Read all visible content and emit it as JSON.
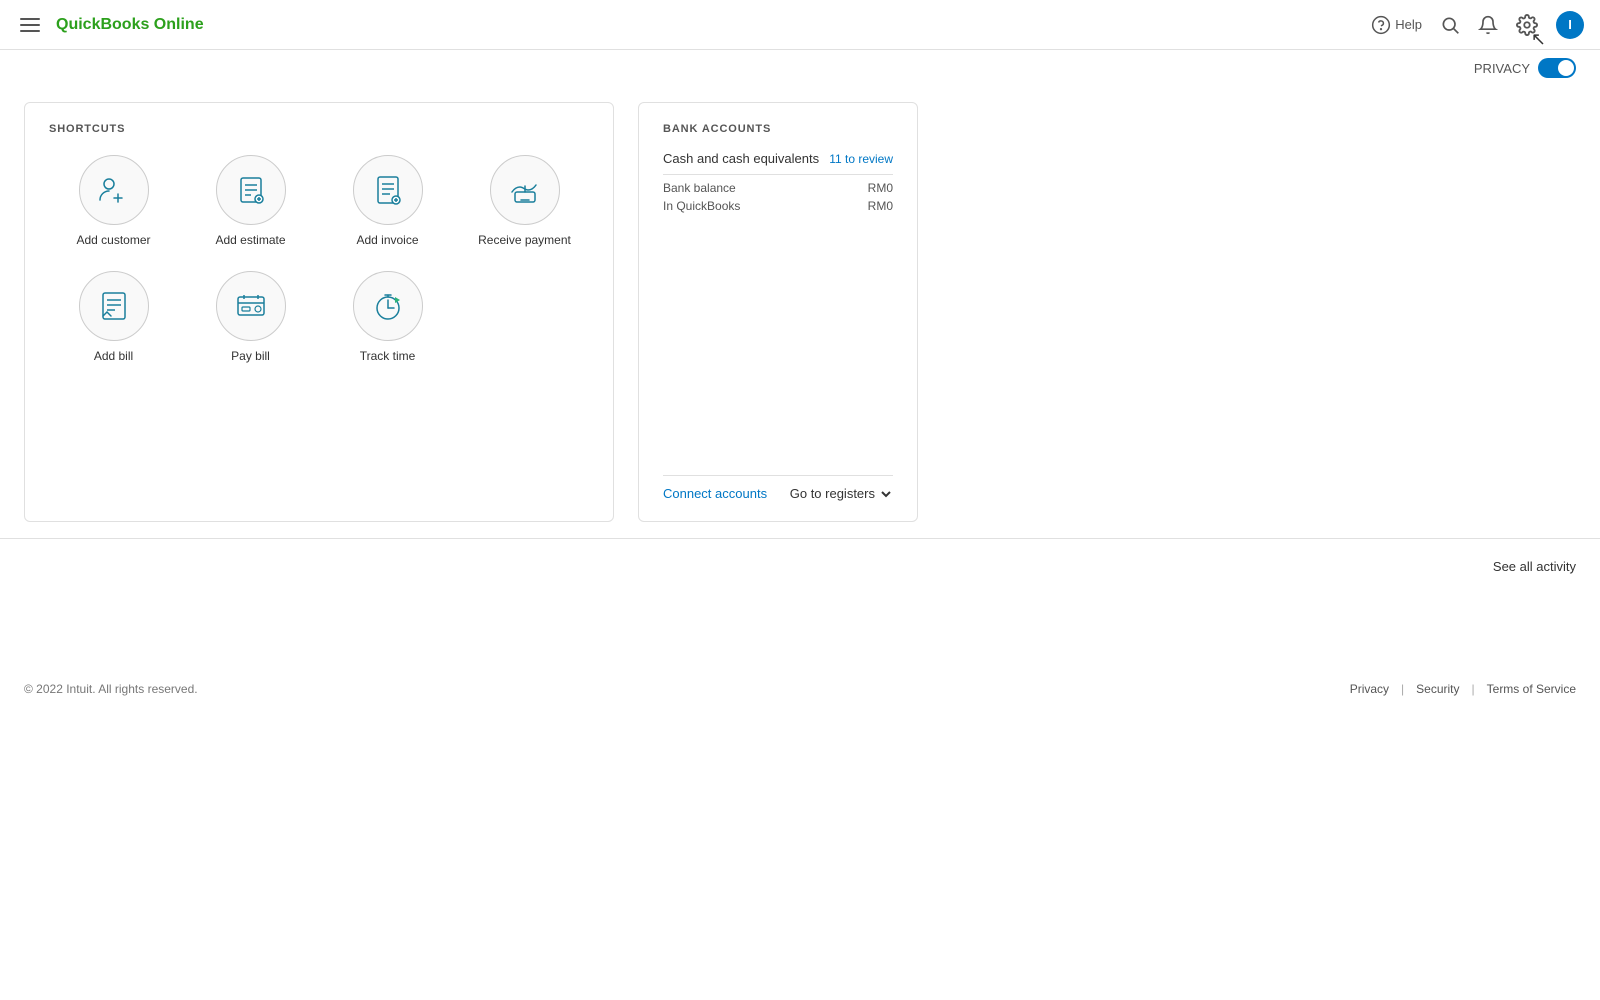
{
  "app": {
    "title": "QuickBooks Online",
    "brand_color": "#2ca01c"
  },
  "header": {
    "help_label": "Help",
    "privacy_label": "PRIVACY",
    "menu_icon": "hamburger-menu-icon",
    "search_icon": "search-icon",
    "bell_icon": "notifications-icon",
    "gear_icon": "settings-icon",
    "avatar_icon": "user-avatar-icon",
    "avatar_letter": "I"
  },
  "shortcuts": {
    "section_title": "SHORTCUTS",
    "items": [
      {
        "label": "Add customer",
        "icon": "add-customer-icon"
      },
      {
        "label": "Add estimate",
        "icon": "add-estimate-icon"
      },
      {
        "label": "Add invoice",
        "icon": "add-invoice-icon"
      },
      {
        "label": "Receive payment",
        "icon": "receive-payment-icon"
      },
      {
        "label": "Add bill",
        "icon": "add-bill-icon"
      },
      {
        "label": "Pay bill",
        "icon": "pay-bill-icon"
      },
      {
        "label": "Track time",
        "icon": "track-time-icon"
      }
    ]
  },
  "bank_accounts": {
    "section_title": "BANK ACCOUNTS",
    "cash_label": "Cash and cash equivalents",
    "review_count": "11 to review",
    "bank_balance_label": "Bank balance",
    "bank_balance_value": "RM0",
    "in_quickbooks_label": "In QuickBooks",
    "in_quickbooks_value": "RM0",
    "connect_accounts_label": "Connect accounts",
    "go_to_registers_label": "Go to registers"
  },
  "activity": {
    "see_all_label": "See all activity"
  },
  "footer": {
    "copyright": "© 2022 Intuit. All rights reserved.",
    "links": [
      {
        "label": "Privacy"
      },
      {
        "label": "Security"
      },
      {
        "label": "Terms of Service"
      }
    ]
  }
}
